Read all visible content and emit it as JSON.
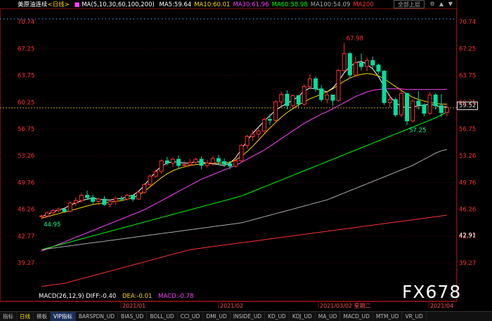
{
  "header": {
    "instrument": "美原油连续",
    "period": "<日线>",
    "ma_params": "MA(5,10,30,60,100,200)",
    "ma_values": [
      {
        "label": "MA5:59.64",
        "color": "#ffffff"
      },
      {
        "label": "MA10:60.01",
        "color": "#ffd800"
      },
      {
        "label": "MA30:61.96",
        "color": "#ff40ff"
      },
      {
        "label": "MA60:58.98",
        "color": "#00ff00"
      },
      {
        "label": "MA100:54.09",
        "color": "#aaaaaa"
      },
      {
        "label": "MA200",
        "color": "#ff3030"
      }
    ],
    "full_button": "全部上层",
    "icons": [
      "settings-icon",
      "up-icon",
      "down-icon"
    ]
  },
  "macd": {
    "label": "MACD(26,12,9)",
    "diff": "DIFF:-0.40",
    "dea": "DEA:-0.01",
    "macd": "MACD:-0.78"
  },
  "right_axis": {
    "current_price": "59.52",
    "lower_label": "42.91"
  },
  "watermark": "FX678",
  "tabs": [
    "日线",
    "模板",
    "VIP指标",
    "BARSPDN_UD",
    "BIAS_UD",
    "BOLL_UD",
    "CCI_UD",
    "DMI_UD",
    "INSIDE_UD",
    "KD_UD",
    "KDJ_UD",
    "MA_UD",
    "MACD_UD",
    "MTM_UD",
    "VR_UD"
  ],
  "tabs_prefix": "指标",
  "chart_data": {
    "type": "candlestick",
    "title": "美原油连续 <日线>",
    "y_ticks": [
      70.74,
      67.25,
      63.75,
      60.25,
      56.75,
      53.26,
      49.76,
      46.26,
      42.77,
      39.27
    ],
    "ylim": [
      35.8,
      72.5
    ],
    "x_ticks": [
      "2021/01",
      "2021/02",
      "2021/03/02 星期二",
      "2021/04"
    ],
    "annotations": [
      {
        "label": "67.98",
        "value": 67.98,
        "kind": "high"
      },
      {
        "label": "57.25",
        "value": 57.25,
        "kind": "low"
      },
      {
        "label": "44.95",
        "value": 44.95,
        "kind": "low"
      }
    ],
    "current_price": 59.52,
    "candles": [
      [
        45.3,
        45.6,
        45.0,
        45.4
      ],
      [
        45.4,
        46.0,
        45.2,
        45.8
      ],
      [
        45.8,
        46.3,
        45.5,
        46.1
      ],
      [
        46.1,
        46.5,
        45.9,
        46.3
      ],
      [
        46.3,
        46.2,
        45.8,
        46.0
      ],
      [
        46.0,
        47.3,
        45.9,
        47.1
      ],
      [
        47.1,
        47.8,
        46.7,
        47.4
      ],
      [
        47.4,
        48.4,
        47.1,
        48.1
      ],
      [
        48.1,
        48.7,
        47.5,
        47.8
      ],
      [
        47.8,
        48.2,
        47.0,
        47.3
      ],
      [
        47.3,
        47.8,
        46.8,
        47.6
      ],
      [
        47.6,
        48.0,
        46.7,
        46.9
      ],
      [
        46.9,
        47.5,
        46.5,
        47.3
      ],
      [
        47.3,
        47.9,
        46.9,
        47.7
      ],
      [
        47.7,
        48.0,
        47.3,
        47.6
      ],
      [
        47.6,
        48.3,
        47.4,
        48.1
      ],
      [
        48.1,
        48.0,
        47.3,
        47.6
      ],
      [
        47.6,
        48.8,
        47.5,
        48.5
      ],
      [
        48.5,
        49.7,
        48.3,
        49.5
      ],
      [
        49.5,
        50.8,
        49.2,
        50.6
      ],
      [
        50.6,
        51.5,
        50.4,
        51.2
      ],
      [
        51.2,
        52.8,
        50.9,
        52.6
      ],
      [
        52.6,
        53.1,
        52.0,
        52.3
      ],
      [
        52.3,
        53.0,
        51.8,
        52.8
      ],
      [
        52.8,
        53.3,
        51.5,
        52.0
      ],
      [
        52.0,
        52.6,
        51.7,
        52.1
      ],
      [
        52.1,
        52.8,
        51.9,
        52.4
      ],
      [
        52.4,
        53.0,
        52.2,
        52.8
      ],
      [
        52.8,
        53.2,
        51.5,
        52.0
      ],
      [
        52.0,
        52.7,
        51.7,
        52.3
      ],
      [
        52.3,
        53.2,
        52.0,
        52.9
      ],
      [
        52.9,
        53.4,
        52.1,
        52.5
      ],
      [
        52.5,
        52.9,
        51.8,
        52.2
      ],
      [
        52.2,
        52.6,
        51.5,
        51.9
      ],
      [
        51.9,
        52.9,
        51.7,
        52.6
      ],
      [
        52.6,
        54.8,
        52.4,
        54.6
      ],
      [
        54.6,
        56.0,
        54.2,
        55.8
      ],
      [
        55.8,
        56.6,
        55.2,
        56.1
      ],
      [
        56.1,
        56.8,
        55.5,
        56.5
      ],
      [
        56.5,
        58.3,
        56.2,
        58.0
      ],
      [
        58.0,
        58.7,
        57.3,
        57.9
      ],
      [
        57.9,
        60.5,
        57.6,
        60.3
      ],
      [
        60.3,
        61.6,
        59.8,
        61.3
      ],
      [
        61.3,
        61.8,
        59.3,
        59.8
      ],
      [
        59.8,
        61.3,
        59.5,
        61.1
      ],
      [
        61.1,
        61.2,
        59.6,
        60.0
      ],
      [
        60.0,
        62.6,
        59.8,
        62.3
      ],
      [
        62.3,
        63.9,
        62.0,
        63.3
      ],
      [
        63.3,
        63.6,
        61.6,
        62.0
      ],
      [
        62.0,
        62.5,
        60.3,
        60.6
      ],
      [
        60.6,
        61.6,
        60.1,
        61.2
      ],
      [
        61.2,
        61.1,
        59.8,
        60.5
      ],
      [
        60.5,
        64.6,
        60.3,
        64.4
      ],
      [
        64.4,
        67.98,
        64.2,
        66.6
      ],
      [
        66.6,
        66.8,
        63.4,
        63.8
      ],
      [
        63.8,
        66.2,
        63.5,
        65.4
      ],
      [
        65.4,
        66.6,
        64.4,
        64.9
      ],
      [
        64.9,
        66.1,
        64.3,
        65.7
      ],
      [
        65.7,
        66.2,
        64.5,
        65.1
      ],
      [
        65.1,
        65.3,
        63.9,
        64.3
      ],
      [
        64.3,
        64.5,
        59.9,
        60.2
      ],
      [
        60.2,
        61.3,
        59.6,
        60.6
      ],
      [
        60.6,
        60.9,
        58.3,
        58.6
      ],
      [
        58.6,
        61.9,
        58.3,
        61.4
      ],
      [
        61.4,
        61.5,
        57.25,
        57.8
      ],
      [
        57.8,
        60.6,
        57.6,
        60.4
      ],
      [
        60.4,
        61.7,
        59.3,
        59.9
      ],
      [
        59.9,
        60.1,
        58.4,
        58.8
      ],
      [
        58.8,
        61.6,
        58.6,
        61.2
      ],
      [
        61.2,
        61.4,
        59.3,
        59.8
      ],
      [
        59.8,
        61.3,
        58.3,
        58.9
      ],
      [
        58.9,
        59.9,
        58.4,
        59.52
      ]
    ],
    "ma_series": [
      {
        "name": "MA5",
        "color": "#ffffff",
        "values": [
          45.3,
          45.6,
          45.9,
          46.2,
          46.4,
          46.8,
          47.1,
          47.4,
          47.6,
          47.7,
          47.6,
          47.5,
          47.5,
          47.6,
          47.7,
          47.9,
          48.1,
          48.6,
          49.4,
          50.3,
          51.2,
          51.9,
          52.3,
          52.5,
          52.4,
          52.3,
          52.3,
          52.5,
          52.4,
          52.3,
          52.2,
          52.1,
          52.0,
          52.3,
          53.0,
          54.1,
          55.2,
          56.2,
          57.0,
          57.8,
          58.5,
          59.2,
          59.7,
          60.1,
          60.5,
          61.0,
          61.7,
          62.1,
          62.0,
          61.8,
          61.6,
          62.1,
          63.0,
          64.1,
          64.9,
          65.4,
          65.6,
          65.2,
          64.6,
          63.6,
          62.3,
          61.0,
          60.2,
          59.7,
          59.5,
          59.6,
          59.8,
          59.9,
          60.0,
          59.8,
          59.6,
          59.64
        ]
      },
      {
        "name": "MA10",
        "color": "#ffd800",
        "values": [
          45.1,
          45.3,
          45.5,
          45.7,
          45.9,
          46.1,
          46.3,
          46.5,
          46.7,
          46.9,
          47.0,
          47.1,
          47.2,
          47.3,
          47.4,
          47.6,
          47.8,
          48.1,
          48.6,
          49.2,
          49.8,
          50.4,
          50.9,
          51.3,
          51.6,
          51.8,
          52.0,
          52.1,
          52.2,
          52.3,
          52.3,
          52.3,
          52.3,
          52.4,
          52.7,
          53.2,
          53.8,
          54.5,
          55.3,
          56.1,
          56.9,
          57.6,
          58.3,
          58.9,
          59.4,
          59.9,
          60.3,
          60.7,
          61.0,
          61.3,
          61.6,
          62.0,
          62.5,
          63.0,
          63.4,
          63.7,
          63.9,
          64.0,
          63.9,
          63.7,
          63.3,
          62.8,
          62.3,
          61.8,
          61.3,
          60.9,
          60.6,
          60.4,
          60.2,
          60.1,
          60.0,
          60.01
        ]
      },
      {
        "name": "MA30",
        "color": "#ff40ff",
        "values": [
          40.8,
          41.1,
          41.4,
          41.7,
          42.0,
          42.3,
          42.6,
          42.9,
          43.2,
          43.5,
          43.8,
          44.1,
          44.4,
          44.7,
          45.0,
          45.3,
          45.6,
          45.9,
          46.2,
          46.6,
          47.0,
          47.4,
          47.8,
          48.2,
          48.6,
          49.0,
          49.4,
          49.8,
          50.2,
          50.5,
          50.8,
          51.1,
          51.4,
          51.7,
          52.0,
          52.4,
          52.8,
          53.2,
          53.6,
          54.0,
          54.5,
          55.0,
          55.5,
          56.0,
          56.5,
          57.0,
          57.5,
          57.9,
          58.3,
          58.7,
          59.0,
          59.4,
          59.8,
          60.2,
          60.6,
          61.0,
          61.3,
          61.6,
          61.8,
          61.9,
          62.0,
          62.0,
          62.0,
          62.0,
          61.9,
          61.9,
          61.9,
          61.9,
          61.9,
          61.9,
          61.9,
          61.96
        ]
      },
      {
        "name": "MA60",
        "color": "#00ff00",
        "values": [
          41.0,
          41.2,
          41.4,
          41.6,
          41.8,
          42.0,
          42.2,
          42.4,
          42.6,
          42.8,
          43.0,
          43.2,
          43.4,
          43.6,
          43.8,
          44.0,
          44.2,
          44.4,
          44.6,
          44.8,
          45.0,
          45.2,
          45.4,
          45.6,
          45.8,
          46.0,
          46.2,
          46.4,
          46.6,
          46.8,
          47.0,
          47.2,
          47.4,
          47.6,
          47.8,
          48.0,
          48.3,
          48.6,
          48.9,
          49.2,
          49.5,
          49.8,
          50.1,
          50.4,
          50.7,
          51.0,
          51.3,
          51.6,
          51.9,
          52.2,
          52.5,
          52.8,
          53.1,
          53.4,
          53.7,
          54.0,
          54.3,
          54.6,
          54.9,
          55.2,
          55.5,
          55.8,
          56.1,
          56.4,
          56.7,
          57.0,
          57.3,
          57.6,
          57.9,
          58.2,
          58.6,
          58.98
        ]
      },
      {
        "name": "MA100",
        "color": "#aaaaaa",
        "values": [
          41.0,
          41.1,
          41.2,
          41.3,
          41.4,
          41.5,
          41.6,
          41.7,
          41.8,
          41.9,
          42.0,
          42.1,
          42.2,
          42.3,
          42.4,
          42.5,
          42.6,
          42.7,
          42.8,
          42.9,
          43.0,
          43.1,
          43.2,
          43.3,
          43.4,
          43.5,
          43.6,
          43.7,
          43.8,
          43.9,
          44.0,
          44.1,
          44.2,
          44.3,
          44.4,
          44.5,
          44.7,
          44.9,
          45.1,
          45.3,
          45.5,
          45.7,
          45.9,
          46.1,
          46.3,
          46.5,
          46.7,
          46.9,
          47.1,
          47.3,
          47.5,
          47.8,
          48.1,
          48.4,
          48.7,
          49.0,
          49.3,
          49.6,
          49.9,
          50.2,
          50.5,
          50.8,
          51.1,
          51.4,
          51.7,
          52.0,
          52.4,
          52.8,
          53.2,
          53.6,
          53.9,
          54.09
        ]
      },
      {
        "name": "MA200",
        "color": "#ff3030",
        "values": [
          36.2,
          36.3,
          36.4,
          36.5,
          36.6,
          36.8,
          37.0,
          37.2,
          37.4,
          37.6,
          37.8,
          38.0,
          38.2,
          38.4,
          38.6,
          38.8,
          39.0,
          39.2,
          39.4,
          39.6,
          39.8,
          40.0,
          40.2,
          40.4,
          40.6,
          40.8,
          41.0,
          41.1,
          41.2,
          41.3,
          41.4,
          41.5,
          41.6,
          41.7,
          41.8,
          41.9,
          42.0,
          42.1,
          42.2,
          42.3,
          42.4,
          42.5,
          42.6,
          42.7,
          42.8,
          42.9,
          43.0,
          43.1,
          43.2,
          43.3,
          43.4,
          43.5,
          43.6,
          43.7,
          43.8,
          43.9,
          44.0,
          44.1,
          44.2,
          44.3,
          44.4,
          44.5,
          44.6,
          44.7,
          44.8,
          44.9,
          45.0,
          45.1,
          45.2,
          45.3,
          45.4,
          45.5
        ]
      }
    ]
  },
  "colors": {
    "up": "#ff3030",
    "down": "#00e0a0",
    "axis_text": "#ff3030",
    "grid": "#7a1010",
    "dotted_line": "#2aa0ff"
  }
}
